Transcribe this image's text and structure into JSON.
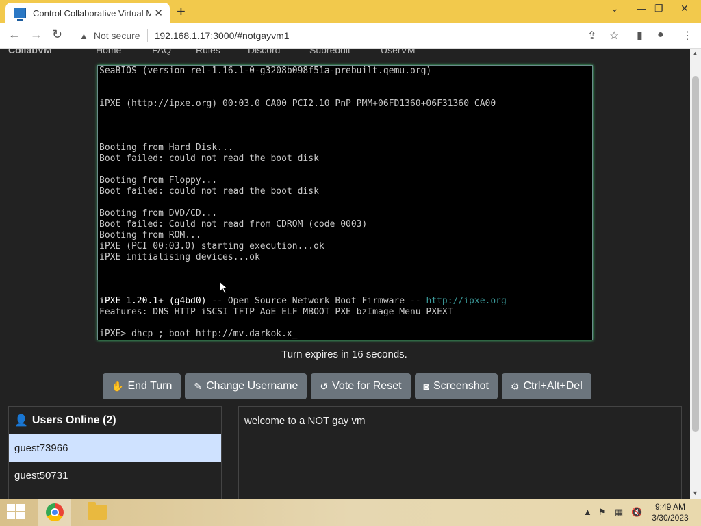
{
  "browser": {
    "tab_title": "Control Collaborative Virtual Mac",
    "tab_close": "✕",
    "new_tab": "+",
    "security_label": "Not secure",
    "url": "192.168.1.17:3000/#notgayvm1",
    "icons": [
      "back-icon",
      "forward-icon",
      "reload-icon",
      "warning-icon",
      "share-icon",
      "star-icon",
      "sidepanel-icon",
      "profile-icon",
      "menu-icon"
    ]
  },
  "site_nav": {
    "brand": "CollabVM",
    "items": [
      "Home",
      "FAQ",
      "Rules",
      "Discord",
      "Subreddit",
      "UserVM"
    ]
  },
  "console": {
    "lines": [
      "SeaBIOS (version rel-1.16.1-0-g3208b098f51a-prebuilt.qemu.org)",
      "",
      "",
      "iPXE (http://ipxe.org) 00:03.0 CA00 PCI2.10 PnP PMM+06FD1360+06F31360 CA00",
      "",
      "",
      "",
      "Booting from Hard Disk...",
      "Boot failed: could not read the boot disk",
      "",
      "Booting from Floppy...",
      "Boot failed: could not read the boot disk",
      "",
      "Booting from DVD/CD...",
      "Boot failed: Could not read from CDROM (code 0003)",
      "Booting from ROM...",
      "iPXE (PCI 00:03.0) starting execution...ok",
      "iPXE initialising devices...ok",
      "",
      "",
      "",
      "iPXE 1.20.1+ (g4bd0) -- Open Source Network Boot Firmware -- http://ipxe.org",
      "Features: DNS HTTP iSCSI TFTP AoE ELF MBOOT PXE bzImage Menu PXEXT",
      "",
      "iPXE> dhcp ; boot http://mv.darkok.x_"
    ]
  },
  "turn_status": "Turn expires in 16 seconds.",
  "buttons": {
    "end_turn": "End Turn",
    "change_username": "Change Username",
    "vote_reset": "Vote for Reset",
    "screenshot": "Screenshot",
    "ctrl_alt_del": "Ctrl+Alt+Del"
  },
  "users": {
    "header": "Users Online (2)",
    "list": [
      "guest73966",
      "guest50731"
    ]
  },
  "chat": {
    "messages": [
      "welcome to a NOT gay vm"
    ]
  },
  "taskbar": {
    "time": "9:49 AM",
    "date": "3/30/2023"
  }
}
